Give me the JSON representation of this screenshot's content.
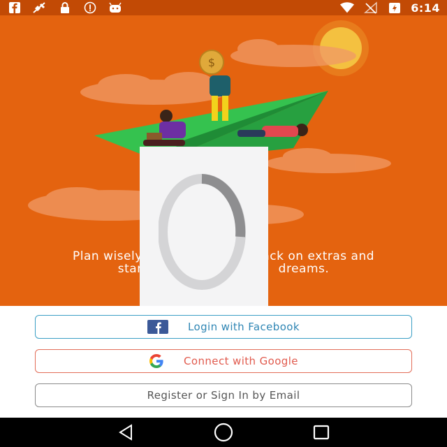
{
  "status_bar": {
    "time": "6:14",
    "left_icons": [
      "facebook-notification-icon",
      "signal-off-icon",
      "lock-icon",
      "do-not-disturb-icon",
      "android-icon"
    ],
    "right_icons": [
      "wifi-icon",
      "no-signal-icon",
      "battery-charging-icon"
    ]
  },
  "onboarding": {
    "caption_left": "Plan wisely w",
    "caption_right": "back on extras and",
    "caption_line2_left": "star",
    "caption_line2_right": "dreams.",
    "pages": 2,
    "active_page": 2
  },
  "loading": {
    "visible": true
  },
  "buttons": {
    "facebook_label": "Login with Facebook",
    "google_label": "Connect with Google",
    "email_label": "Register or Sign In by Email"
  },
  "nav": {
    "back": "back-icon",
    "home": "home-icon",
    "recents": "recents-icon"
  },
  "colors": {
    "hero_bg": "#e4630f",
    "status_bg": "#c24a05",
    "facebook": "#3b5998",
    "facebook_border": "#3a9ec4",
    "google_text": "#e15a4d",
    "plane_green": "#2db34a"
  }
}
